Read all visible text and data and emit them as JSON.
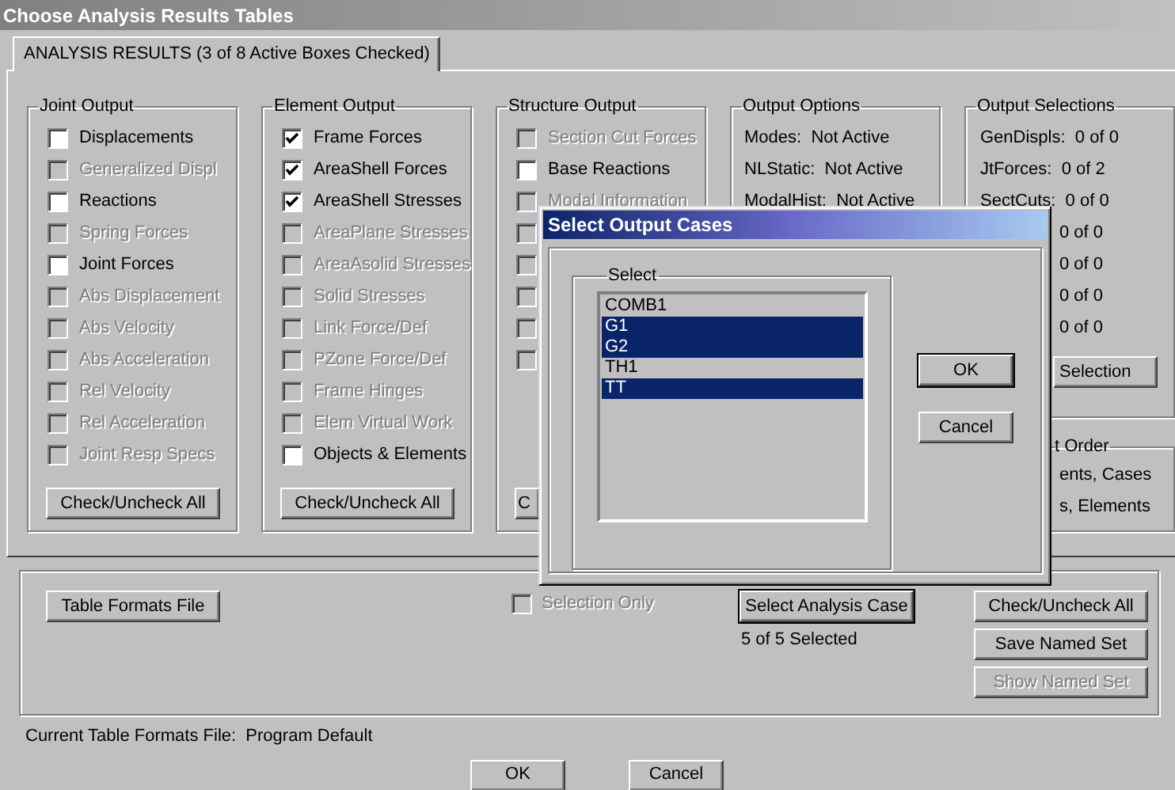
{
  "window": {
    "title": "Choose Analysis Results Tables"
  },
  "tabs": [
    {
      "label": "ANALYSIS RESULTS (3 of 8 Active Boxes Checked)",
      "selected": true
    }
  ],
  "groups": [
    {
      "title": "Joint Output",
      "items": [
        {
          "label": "Displacements",
          "checked": false,
          "disabled": false
        },
        {
          "label": "Generalized Displ",
          "checked": false,
          "disabled": true
        },
        {
          "label": "Reactions",
          "checked": false,
          "disabled": false
        },
        {
          "label": "Spring Forces",
          "checked": false,
          "disabled": true
        },
        {
          "label": "Joint Forces",
          "checked": false,
          "disabled": false
        },
        {
          "label": "Abs Displacement",
          "checked": false,
          "disabled": true
        },
        {
          "label": "Abs Velocity",
          "checked": false,
          "disabled": true
        },
        {
          "label": "Abs Acceleration",
          "checked": false,
          "disabled": true
        },
        {
          "label": "Rel Velocity",
          "checked": false,
          "disabled": true
        },
        {
          "label": "Rel Acceleration",
          "checked": false,
          "disabled": true
        },
        {
          "label": "Joint Resp Specs",
          "checked": false,
          "disabled": true
        }
      ],
      "button": "Check/Uncheck All"
    },
    {
      "title": "Element Output",
      "items": [
        {
          "label": "Frame Forces",
          "checked": true,
          "disabled": false
        },
        {
          "label": "AreaShell Forces",
          "checked": true,
          "disabled": false
        },
        {
          "label": "AreaShell Stresses",
          "checked": true,
          "disabled": false
        },
        {
          "label": "AreaPlane Stresses",
          "checked": false,
          "disabled": true
        },
        {
          "label": "AreaAsolid  Stresses",
          "checked": false,
          "disabled": true
        },
        {
          "label": "Solid Stresses",
          "checked": false,
          "disabled": true
        },
        {
          "label": "Link Force/Def",
          "checked": false,
          "disabled": true
        },
        {
          "label": "PZone Force/Def",
          "checked": false,
          "disabled": true
        },
        {
          "label": "Frame Hinges",
          "checked": false,
          "disabled": true
        },
        {
          "label": "Elem Virtual Work",
          "checked": false,
          "disabled": true
        },
        {
          "label": "Objects & Elements",
          "checked": false,
          "disabled": false
        }
      ],
      "button": "Check/Uncheck All"
    },
    {
      "title": "Structure Output",
      "items": [
        {
          "label": "Section Cut Forces",
          "checked": false,
          "disabled": true
        },
        {
          "label": "Base Reactions",
          "checked": false,
          "disabled": false
        },
        {
          "label": "Modal Information",
          "checked": false,
          "disabled": true
        },
        {
          "checked": false,
          "disabled": true
        },
        {
          "checked": false,
          "disabled": true
        },
        {
          "checked": false,
          "disabled": true
        },
        {
          "checked": false,
          "disabled": true
        },
        {
          "checked": false,
          "disabled": true
        }
      ],
      "button": "C"
    }
  ],
  "output_options": {
    "title": "Output Options",
    "lines": [
      "Modes:  Not Active",
      "NLStatic:  Not Active",
      "ModalHist:  Not Active"
    ]
  },
  "output_selections": {
    "title": "Output Selections",
    "lines": [
      {
        "kind": "label",
        "text": "GenDispls:  0 of 0"
      },
      {
        "kind": "label",
        "text": "JtForces:  0 of 2"
      },
      {
        "kind": "label",
        "text": "SectCuts:  0 of 0"
      },
      {
        "kind": "value",
        "text": "0 of 0"
      },
      {
        "kind": "value",
        "text": "0 of 0"
      },
      {
        "kind": "value",
        "text": "0 of 0"
      },
      {
        "kind": "value",
        "text": "0 of 0"
      }
    ],
    "button": "Selection"
  },
  "sort_order": {
    "title": "t Order",
    "lines": [
      "ents, Cases",
      "s, Elements"
    ]
  },
  "bottom": {
    "table_formats_button": "Table Formats File",
    "selection_only": {
      "label": "Selection Only",
      "checked": false,
      "disabled": true
    },
    "select_case_button": "Select Analysis Case",
    "selected_count": "5 of 5 Selected",
    "side_buttons": [
      {
        "label": "Check/Uncheck All",
        "disabled": false
      },
      {
        "label": "Save Named Set",
        "disabled": false
      },
      {
        "label": "Show Named Set",
        "disabled": true
      }
    ]
  },
  "current_file": "Current Table Formats File:  Program Default",
  "buttons": [
    "OK",
    "Cancel"
  ],
  "modal": {
    "title": "Select Output Cases",
    "group": "Select",
    "cases": [
      {
        "label": "COMB1",
        "selected": false
      },
      {
        "label": "G1",
        "selected": true
      },
      {
        "label": "G2",
        "selected": true
      },
      {
        "label": "TH1",
        "selected": false
      },
      {
        "label": "TT",
        "selected": true
      }
    ],
    "buttons": [
      "OK",
      "Cancel"
    ]
  }
}
